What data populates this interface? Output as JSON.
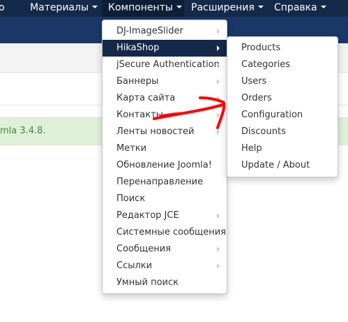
{
  "navbar": {
    "items": [
      {
        "label": "о",
        "has_caret": false
      },
      {
        "label": "Материалы",
        "has_caret": true
      },
      {
        "label": "Компоненты",
        "has_caret": true
      },
      {
        "label": "Расширения",
        "has_caret": true
      },
      {
        "label": "Справка",
        "has_caret": true
      }
    ]
  },
  "notice": {
    "text": "mla 3.4.8."
  },
  "components_menu": {
    "items": [
      {
        "label": "DJ-ImageSlider",
        "has_submenu": true
      },
      {
        "label": "HikaShop",
        "has_submenu": true
      },
      {
        "label": "jSecure Authentication",
        "has_submenu": true
      },
      {
        "label": "Баннеры",
        "has_submenu": true
      },
      {
        "label": "Карта сайта",
        "has_submenu": true
      },
      {
        "label": "Контакты",
        "has_submenu": true
      },
      {
        "label": "Ленты новостей",
        "has_submenu": true
      },
      {
        "label": "Метки",
        "has_submenu": false
      },
      {
        "label": "Обновление Joomla!",
        "has_submenu": false
      },
      {
        "label": "Перенаправление",
        "has_submenu": false
      },
      {
        "label": "Поиск",
        "has_submenu": false
      },
      {
        "label": "Редактор JCE",
        "has_submenu": true
      },
      {
        "label": "Системные сообщения",
        "has_submenu": false
      },
      {
        "label": "Сообщения",
        "has_submenu": true
      },
      {
        "label": "Ссылки",
        "has_submenu": true
      },
      {
        "label": "Умный поиск",
        "has_submenu": false
      }
    ]
  },
  "hikashop_menu": {
    "items": [
      {
        "label": "Products"
      },
      {
        "label": "Categories"
      },
      {
        "label": "Users"
      },
      {
        "label": "Orders"
      },
      {
        "label": "Configuration"
      },
      {
        "label": "Discounts"
      },
      {
        "label": "Help"
      },
      {
        "label": "Update / About"
      }
    ]
  },
  "colors": {
    "navbar": "#15294a",
    "header": "#1a3867",
    "notice_bg": "#dff0d8",
    "notice_text": "#468847",
    "annotation": "#ff0000"
  }
}
